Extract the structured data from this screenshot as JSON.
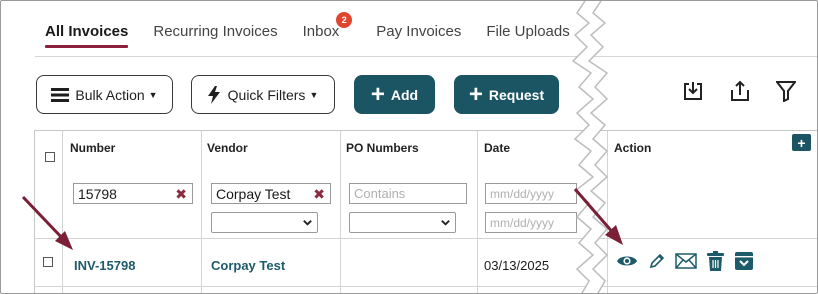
{
  "tabs": [
    {
      "label": "All Invoices",
      "active": true
    },
    {
      "label": "Recurring Invoices",
      "active": false
    },
    {
      "label": "Inbox",
      "active": false,
      "badge": "2"
    },
    {
      "label": "Pay Invoices",
      "active": false
    },
    {
      "label": "File Uploads",
      "active": false
    }
  ],
  "toolbar": {
    "bulk_action": "Bulk Action",
    "quick_filters": "Quick Filters",
    "add": "Add",
    "request": "Request"
  },
  "table": {
    "headers": {
      "number": "Number",
      "vendor": "Vendor",
      "po_numbers": "PO Numbers",
      "date": "Date",
      "action": "Action"
    },
    "filters": {
      "number_value": "15798",
      "vendor_value": "Corpay Test",
      "po_placeholder": "Contains",
      "date_from_placeholder": "mm/dd/yyyy",
      "date_to_placeholder": "mm/dd/yyyy"
    },
    "rows": [
      {
        "number": "INV-15798",
        "vendor": "Corpay Test",
        "po_numbers": "",
        "date": "03/13/2025"
      }
    ]
  },
  "icons": {
    "import": "download-tray-icon",
    "export": "upload-tray-icon",
    "filter": "funnel-icon",
    "view": "eye-icon",
    "edit": "pencil-icon",
    "email": "envelope-icon",
    "delete": "trash-icon",
    "archive": "archive-box-icon"
  },
  "colors": {
    "accent": "#8e1f3c",
    "primary": "#1b5463",
    "link": "#1e5b6a",
    "badge": "#e0452f",
    "arrow": "#7a1f35"
  }
}
